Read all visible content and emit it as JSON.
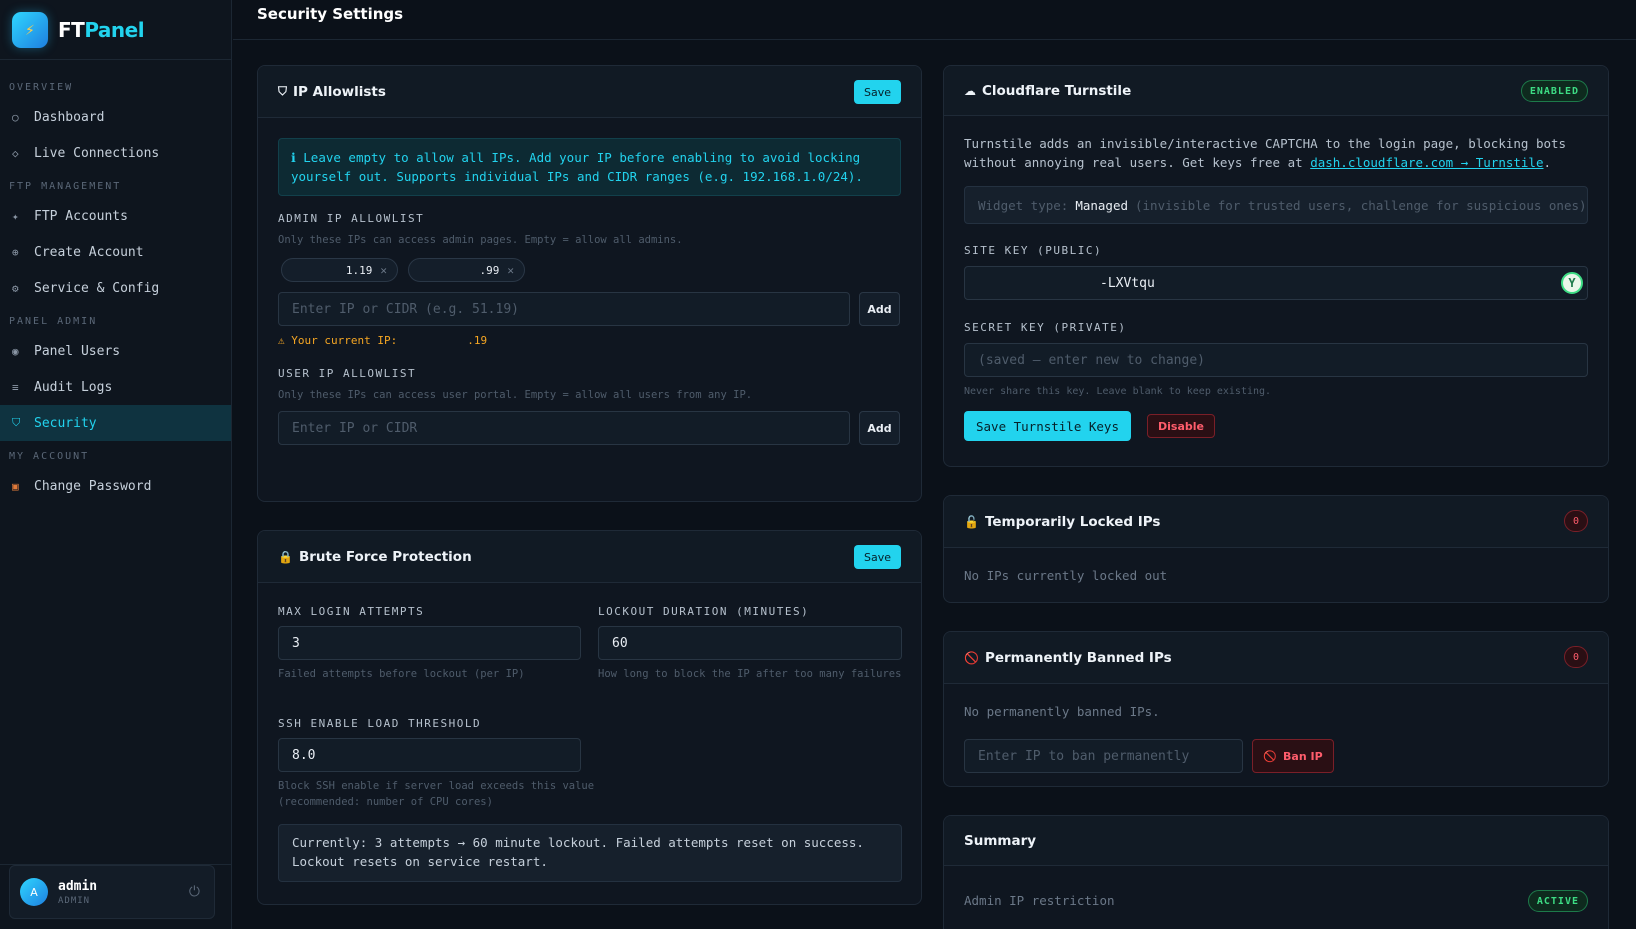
{
  "brand": {
    "name_a": "FT",
    "name_b": "Panel"
  },
  "sidebar": {
    "sections": [
      {
        "label": "OVERVIEW"
      },
      {
        "label": "FTP MANAGEMENT"
      },
      {
        "label": "PANEL ADMIN"
      },
      {
        "label": "MY ACCOUNT"
      }
    ],
    "items": [
      {
        "label": "Dashboard",
        "icon": "circle-icon"
      },
      {
        "label": "Live Connections",
        "icon": "diamond-icon"
      },
      {
        "label": "FTP Accounts",
        "icon": "star-icon"
      },
      {
        "label": "Create Account",
        "icon": "plus-circle-icon"
      },
      {
        "label": "Service & Config",
        "icon": "gear-icon"
      },
      {
        "label": "Panel Users",
        "icon": "user-circle-icon"
      },
      {
        "label": "Audit Logs",
        "icon": "list-icon"
      },
      {
        "label": "Security",
        "icon": "shield-icon",
        "active": true
      },
      {
        "label": "Change Password",
        "icon": "briefcase-icon"
      }
    ],
    "user": {
      "initial": "A",
      "name": "admin",
      "role": "ADMIN"
    }
  },
  "header": {
    "title": "Security Settings"
  },
  "ip_allowlists": {
    "title": "IP Allowlists",
    "save_label": "Save",
    "info": "ℹ Leave empty to allow all IPs. Add your IP before enabling to avoid locking yourself out. Supports individual IPs and CIDR ranges (e.g. 192.168.1.0/24).",
    "admin_label": "ADMIN IP ALLOWLIST",
    "admin_hint": "Only these IPs can access admin pages. Empty = allow all admins.",
    "admin_chips": [
      "1.19",
      ".99"
    ],
    "admin_placeholder": "Enter IP or CIDR (e.g. 51.19)",
    "add_label": "Add",
    "current_ip_label": "Your current IP:",
    "current_ip_value": ".19",
    "user_label": "USER IP ALLOWLIST",
    "user_hint": "Only these IPs can access user portal. Empty = allow all users from any IP.",
    "user_placeholder": "Enter IP or CIDR"
  },
  "brute_force": {
    "title": "Brute Force Protection",
    "save_label": "Save",
    "max_login_label": "MAX LOGIN ATTEMPTS",
    "max_login_value": "3",
    "max_login_hint": "Failed attempts before lockout (per IP)",
    "lockout_label": "LOCKOUT DURATION (MINUTES)",
    "lockout_value": "60",
    "lockout_hint": "How long to block the IP after too many failures",
    "ssh_label": "SSH ENABLE LOAD THRESHOLD",
    "ssh_value": "8.0",
    "ssh_hint_1": "Block SSH enable if server load exceeds this value",
    "ssh_hint_2": "(recommended: number of CPU cores)",
    "summary_1": "Currently: 3 attempts → 60 minute lockout. Failed attempts reset on success.",
    "summary_2": "Lockout resets on service restart."
  },
  "turnstile": {
    "title": "Cloudflare Turnstile",
    "badge": "ENABLED",
    "desc_1": "Turnstile adds an invisible/interactive CAPTCHA to the login page, blocking bots",
    "desc_2": "without annoying real users. Get keys free at ",
    "desc_link": "dash.cloudflare.com → Turnstile",
    "desc_end": ".",
    "widget_prefix": "Widget type:",
    "widget_value": "Managed",
    "widget_suffix": "(invisible for trusted users, challenge for suspicious ones)",
    "site_key_label": "SITE KEY (PUBLIC)",
    "site_key_value": "-LXVtqu",
    "secret_key_label": "SECRET KEY (PRIVATE)",
    "secret_key_placeholder": "(saved — enter new to change)",
    "secret_hint": "Never share this key. Leave blank to keep existing.",
    "save_keys_label": "Save Turnstile Keys",
    "disable_label": "Disable"
  },
  "locked": {
    "title": "Temporarily Locked IPs",
    "count": "0",
    "empty": "No IPs currently locked out"
  },
  "banned": {
    "title": "Permanently Banned IPs",
    "count": "0",
    "empty": "No permanently banned IPs.",
    "placeholder": "Enter IP to ban permanently",
    "ban_label": "Ban IP"
  },
  "summary": {
    "title": "Summary",
    "row_label": "Admin IP restriction",
    "row_status": "ACTIVE"
  },
  "colors": {
    "accent": "#22d3ee",
    "danger": "#ff5d6c",
    "success": "#3ddc84",
    "warning": "#f5a623"
  }
}
